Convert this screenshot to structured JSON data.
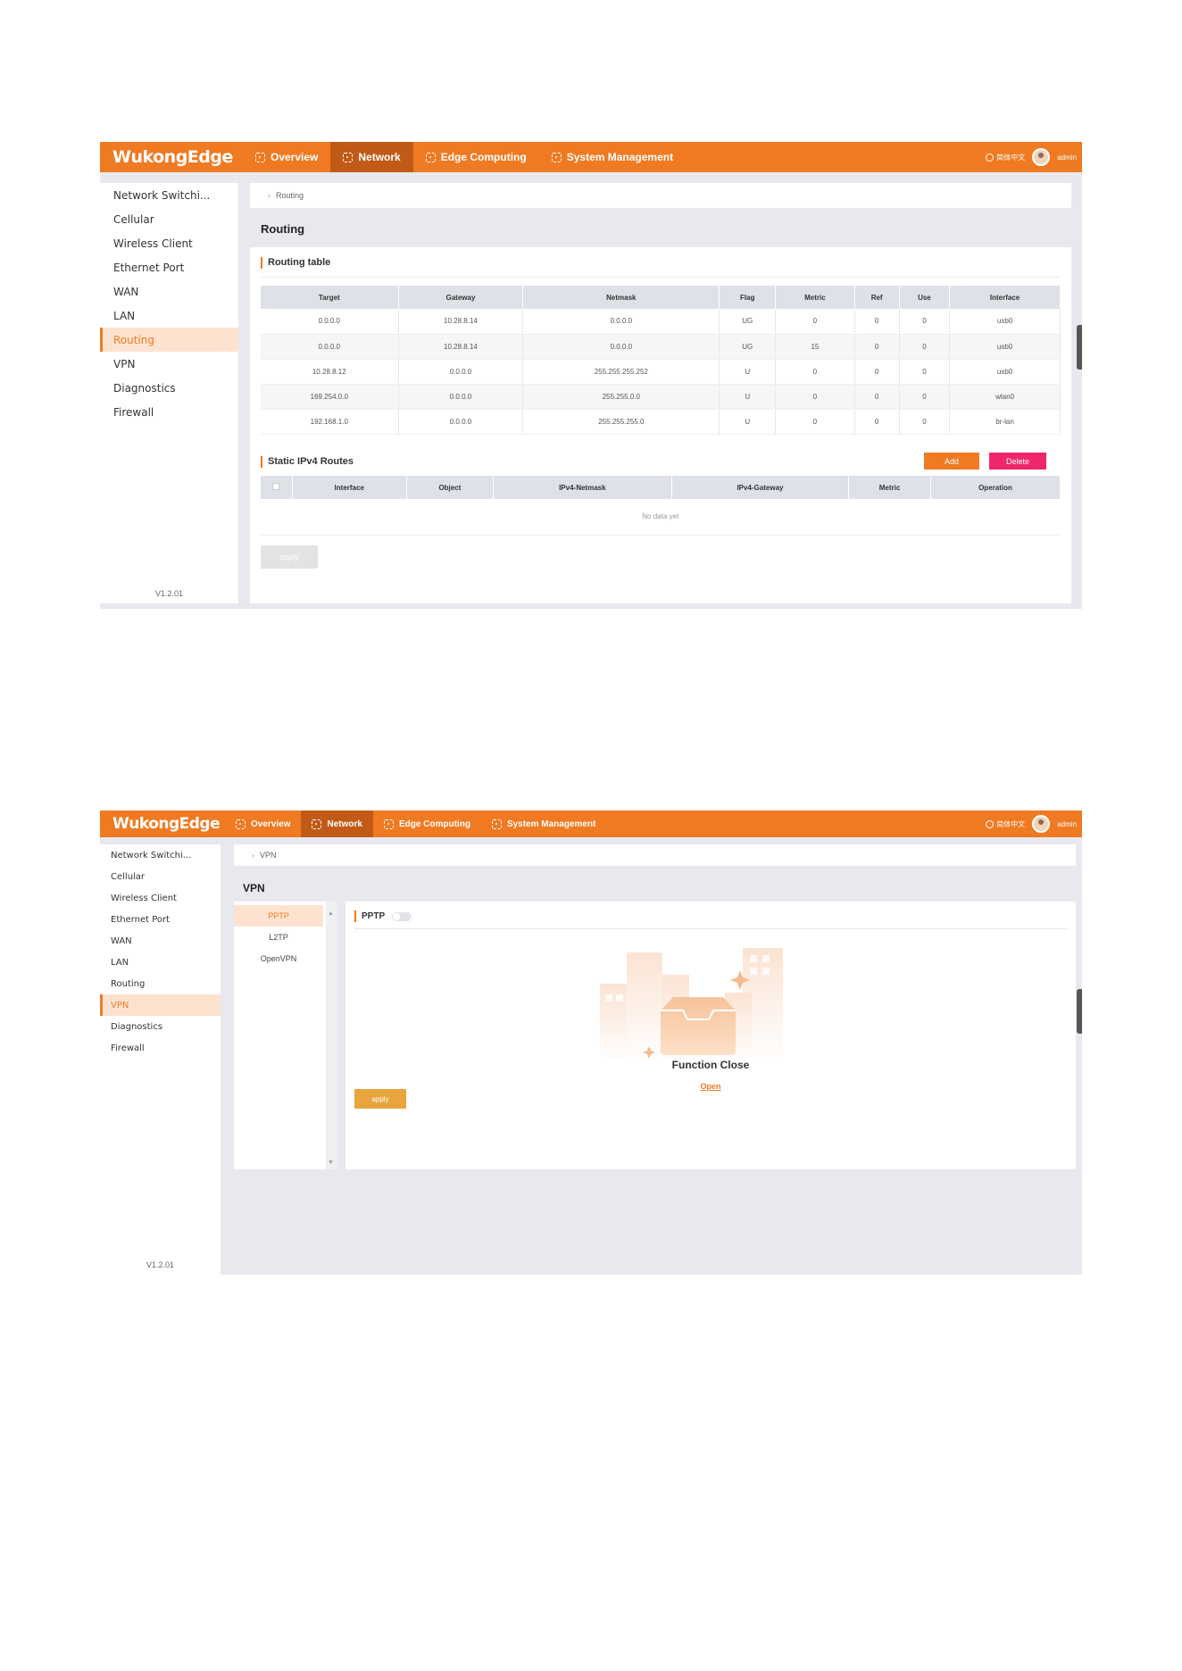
{
  "app": {
    "logo": "WukongEdge",
    "language": "简体中文",
    "user": "admin",
    "version": "V1.2.01"
  },
  "nav": [
    "Overview",
    "Network",
    "Edge Computing",
    "System Management"
  ],
  "sidebar": [
    "Network Switchi...",
    "Cellular",
    "Wireless Client",
    "Ethernet Port",
    "WAN",
    "LAN",
    "Routing",
    "VPN",
    "Diagnostics",
    "Firewall"
  ],
  "routing_page": {
    "breadcrumb": "Routing",
    "title": "Routing",
    "routing_table": {
      "title": "Routing table",
      "columns": [
        "Target",
        "Gateway",
        "Netmask",
        "Flag",
        "Metric",
        "Ref",
        "Use",
        "Interface"
      ],
      "rows": [
        [
          "0.0.0.0",
          "10.28.8.14",
          "0.0.0.0",
          "UG",
          "0",
          "0",
          "0",
          "usb0"
        ],
        [
          "0.0.0.0",
          "10.28.8.14",
          "0.0.0.0",
          "UG",
          "15",
          "0",
          "0",
          "usb0"
        ],
        [
          "10.28.8.12",
          "0.0.0.0",
          "255.255.255.252",
          "U",
          "0",
          "0",
          "0",
          "usb0"
        ],
        [
          "169.254.0.0",
          "0.0.0.0",
          "255.255.0.0",
          "U",
          "0",
          "0",
          "0",
          "wlan0"
        ],
        [
          "192.168.1.0",
          "0.0.0.0",
          "255.255.255.0",
          "U",
          "0",
          "0",
          "0",
          "br-lan"
        ]
      ]
    },
    "static_routes": {
      "title": "Static IPv4 Routes",
      "add_label": "Add",
      "delete_label": "Delete",
      "columns": [
        "Interface",
        "Object",
        "IPv4-Netmask",
        "IPv4-Gateway",
        "Metric",
        "Operation"
      ],
      "empty_text": "No data yet"
    },
    "apply_label": "apply"
  },
  "vpn_page": {
    "breadcrumb": "VPN",
    "title": "VPN",
    "protocols": [
      "PPTP",
      "L2TP",
      "OpenVPN"
    ],
    "panel_title": "PPTP",
    "status_text": "Function Close",
    "open_label": "Open",
    "apply_label": "apply"
  },
  "colors": {
    "brand": "#ef7a22",
    "brand_dark": "#c15a16",
    "delete": "#f0266a",
    "apply_vpn": "#e8a53e",
    "apply_disabled": "#e3e3e6"
  }
}
